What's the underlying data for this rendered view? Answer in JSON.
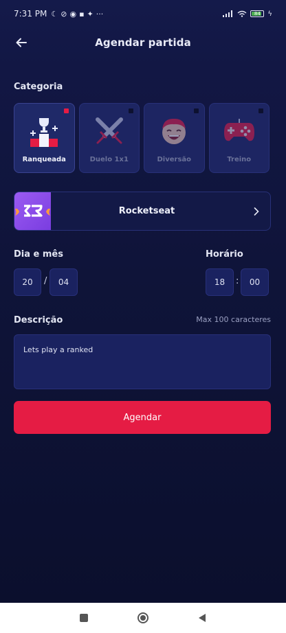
{
  "status_bar": {
    "time": "7:31 PM",
    "battery": "84"
  },
  "header": {
    "title": "Agendar partida"
  },
  "category": {
    "label": "Categoria",
    "items": [
      {
        "label": "Ranqueada",
        "icon": "trophy-podium-icon",
        "selected": true
      },
      {
        "label": "Duelo 1x1",
        "icon": "crossed-swords-icon",
        "selected": false
      },
      {
        "label": "Diversão",
        "icon": "laughing-face-icon",
        "selected": false
      },
      {
        "label": "Treino",
        "icon": "gamepad-icon",
        "selected": false
      }
    ]
  },
  "game": {
    "name": "Rocketseat",
    "icon": "rocketseat-logo"
  },
  "date": {
    "label": "Dia e mês",
    "day": "20",
    "month": "04",
    "separator": "/"
  },
  "time": {
    "label": "Horário",
    "hour": "18",
    "minute": "00",
    "separator": ":"
  },
  "description": {
    "label": "Descrição",
    "hint": "Max 100 caracteres",
    "value": "Lets play a ranked"
  },
  "submit": {
    "label": "Agendar"
  },
  "colors": {
    "background": "#0e1235",
    "primary": "#e51c44",
    "card": "#1d2562",
    "border": "#283179",
    "game_accent": "#8f4cf0"
  }
}
